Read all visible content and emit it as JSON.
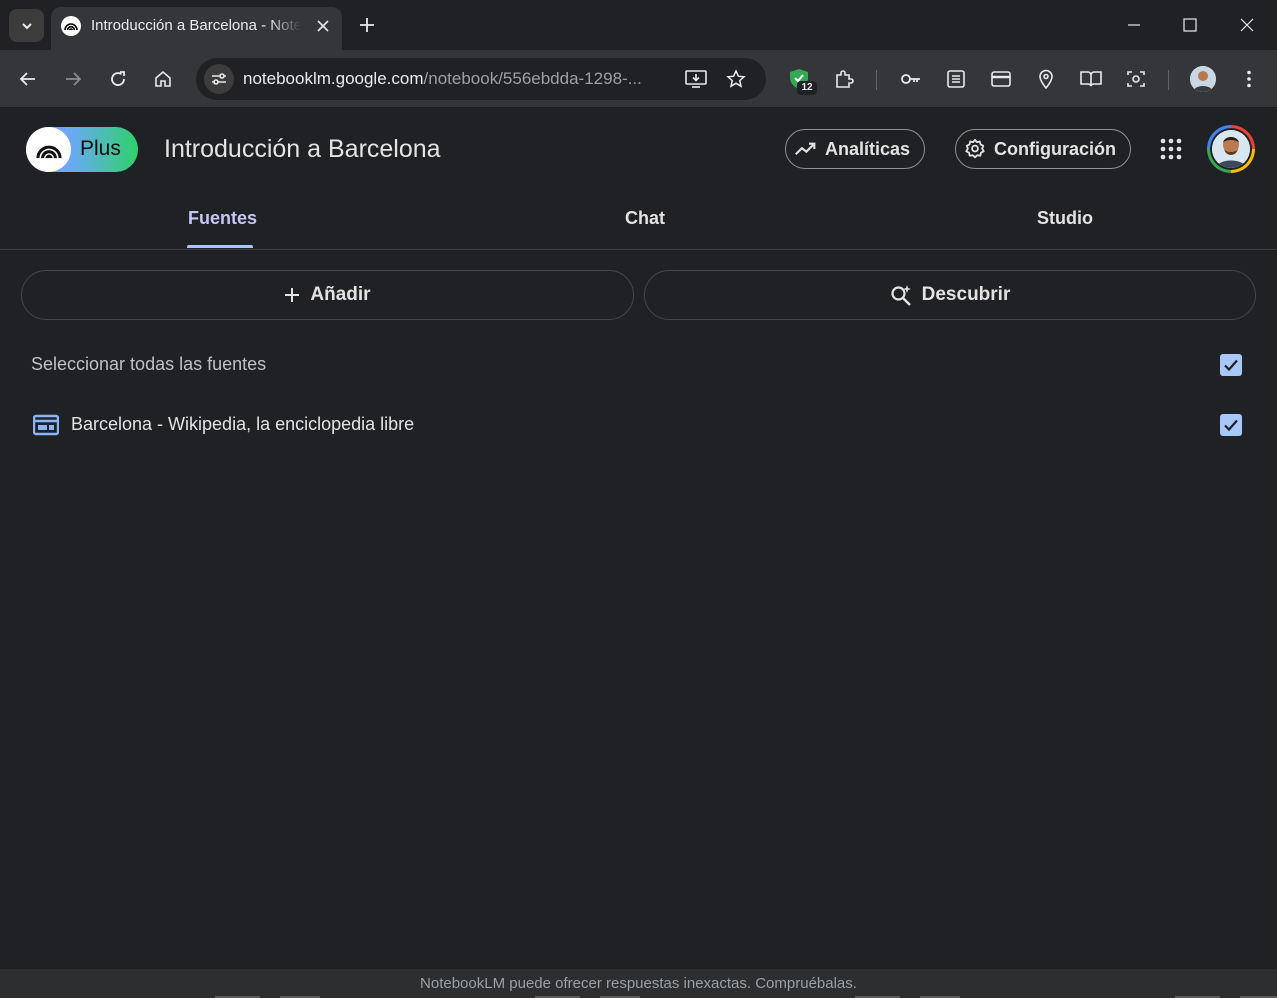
{
  "browser": {
    "tab_title": "Introducción a Barcelona - NotebookLM",
    "new_tab_label": "+",
    "url_host": "notebooklm.google.com",
    "url_path": "/notebook/556ebdda-1298-...",
    "extension_badge": "12"
  },
  "header": {
    "plus_label": "Plus",
    "notebook_title": "Introducción a Barcelona",
    "analytics_label": "Analíticas",
    "settings_label": "Configuración"
  },
  "tabs": [
    {
      "label": "Fuentes",
      "active": true
    },
    {
      "label": "Chat",
      "active": false
    },
    {
      "label": "Studio",
      "active": false
    }
  ],
  "actions": {
    "add_label": "Añadir",
    "discover_label": "Descubrir"
  },
  "sources": {
    "select_all_label": "Seleccionar todas las fuentes",
    "select_all_checked": true,
    "items": [
      {
        "title": "Barcelona - Wikipedia, la enciclopedia libre",
        "type": "web",
        "checked": true
      }
    ]
  },
  "footer": {
    "disclaimer": "NotebookLM puede ofrecer respuestas inexactas. Compruébalas."
  },
  "colors": {
    "background": "#202124",
    "accent": "#a8c7fa",
    "source_icon": "#8ab4f8"
  }
}
